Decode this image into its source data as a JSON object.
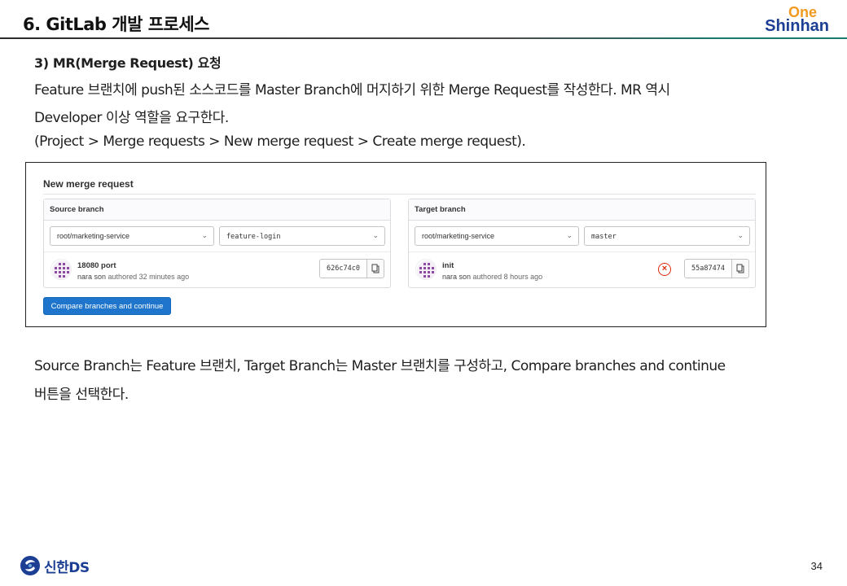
{
  "header": {
    "title": "6. GitLab 개발 프로세스",
    "brand_one": "One",
    "brand_shinhan": "Shinhan"
  },
  "content": {
    "heading": "3) MR(Merge Request) 요청",
    "line1": "Feature 브랜치에 push된 소스코드를 Master Branch에 머지하기 위한 Merge Request를 작성한다. MR 역시",
    "line2": "Developer 이상 역할을 요구한다.",
    "line3": "(Project > Merge requests > New merge request > Create merge request).",
    "after1": "Source Branch는 Feature 브랜치, Target Branch는 Master 브랜치를 구성하고, Compare branches and continue",
    "after2": "버튼을 선택한다."
  },
  "screenshot": {
    "title": "New merge request",
    "source": {
      "label": "Source branch",
      "project": "root/marketing-service",
      "branch": "feature-login",
      "commit_title": "18080 port",
      "author": "nara son",
      "authored": "authored 32 minutes ago",
      "sha": "626c74c0"
    },
    "target": {
      "label": "Target branch",
      "project": "root/marketing-service",
      "branch": "master",
      "commit_title": "init",
      "author": "nara son",
      "authored": "authored 8 hours ago",
      "sha": "55a87474"
    },
    "button": "Compare branches and continue",
    "colors": {
      "button": "#1f75cb",
      "error": "#dd2b0e"
    }
  },
  "footer": {
    "logo_text": "신한DS",
    "page": "34"
  }
}
